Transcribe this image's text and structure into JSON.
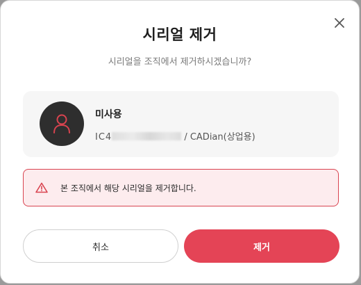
{
  "dialog": {
    "title": "시리얼 제거",
    "subtitle": "시리얼을 조직에서 제거하시겠습니까?",
    "close_icon": "close-icon"
  },
  "user_card": {
    "avatar_icon": "user-icon",
    "name": "미사용",
    "serial_prefix": "IC4",
    "serial_masked": true,
    "product": "/ CADian(상업용)"
  },
  "warning": {
    "icon": "warning-triangle-icon",
    "text": "본 조직에서 해당 시리얼을 제거합니다."
  },
  "buttons": {
    "cancel_label": "취소",
    "remove_label": "제거"
  },
  "colors": {
    "accent": "#e44456",
    "warning_bg": "#fdecee",
    "warning_border": "#d9434f",
    "avatar_bg": "#2e2e2e",
    "card_bg": "#f6f6f6"
  }
}
